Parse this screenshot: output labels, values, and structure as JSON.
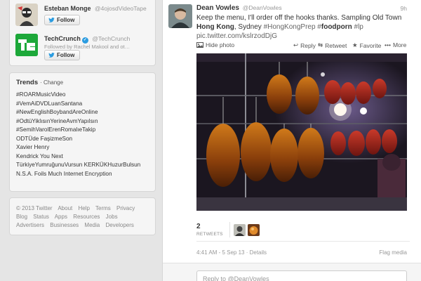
{
  "who_to_follow": [
    {
      "name": "Esteban Monge",
      "handle": "@4ojosdVideoTape",
      "follow_label": "Follow"
    },
    {
      "name": "TechCrunch",
      "handle": "@TechCrunch",
      "followed_by": "Followed by Rachel Makool and ot…",
      "follow_label": "Follow",
      "logo_text": "TC"
    }
  ],
  "trends": {
    "title": "Trends",
    "change_label": "· Change",
    "items": [
      "#ROARMusicVideo",
      "#VemAiDVDLuanSantana",
      "#NewEnglishBoybandAreOnline",
      "#OdtüYiklısınYerineAvmYapılsın",
      "#SemihVarolErenRomalıeTakip",
      "ODTÜde FaşizmeSon",
      "Xavier Henry",
      "Kendrick You Next",
      "TürkiyeYumruğunuVursun KERKÜKHuzurBulsun",
      "N.S.A. Foils Much Internet Encryption"
    ]
  },
  "footer": {
    "lines": [
      [
        "© 2013 Twitter",
        "About",
        "Help",
        "Terms",
        "Privacy"
      ],
      [
        "Blog",
        "Status",
        "Apps",
        "Resources",
        "Jobs"
      ],
      [
        "Advertisers",
        "Businesses",
        "Media",
        "Developers"
      ]
    ]
  },
  "tweet": {
    "author_name": "Dean Vowles",
    "author_handle": "@DeanVowles",
    "time": "9h",
    "text_part1": "Keep the menu, I'll order off the hooks thanks. Sampling Old Town ",
    "text_bold1": "Hong Kong",
    "text_part2": ", Sydney ",
    "text_hashtag1": "#HongKongPrep",
    "text_hashtag2_hash": " #",
    "text_hashtag2_word": "foodporn",
    "text_hashtag3": " #lp",
    "text_link": "pic.twitter.com/kslrzodDjG",
    "hide_photo": "Hide photo",
    "reply": "Reply",
    "retweet": "Retweet",
    "favorite": "Favorite",
    "more": "More",
    "retweet_count": "2",
    "retweets_label": "RETWEETS",
    "meta": "4:41 AM - 5 Sep 13 · Details",
    "flag": "Flag media",
    "reply_placeholder": "Reply to @DeanVowles"
  },
  "colors": {
    "page_bg": "#e5e5e5",
    "card_bg": "#f5f5f5",
    "techcrunch_green": "#1da83a",
    "verified_blue": "#2b9ce0",
    "link_blue": "#0084b4"
  }
}
